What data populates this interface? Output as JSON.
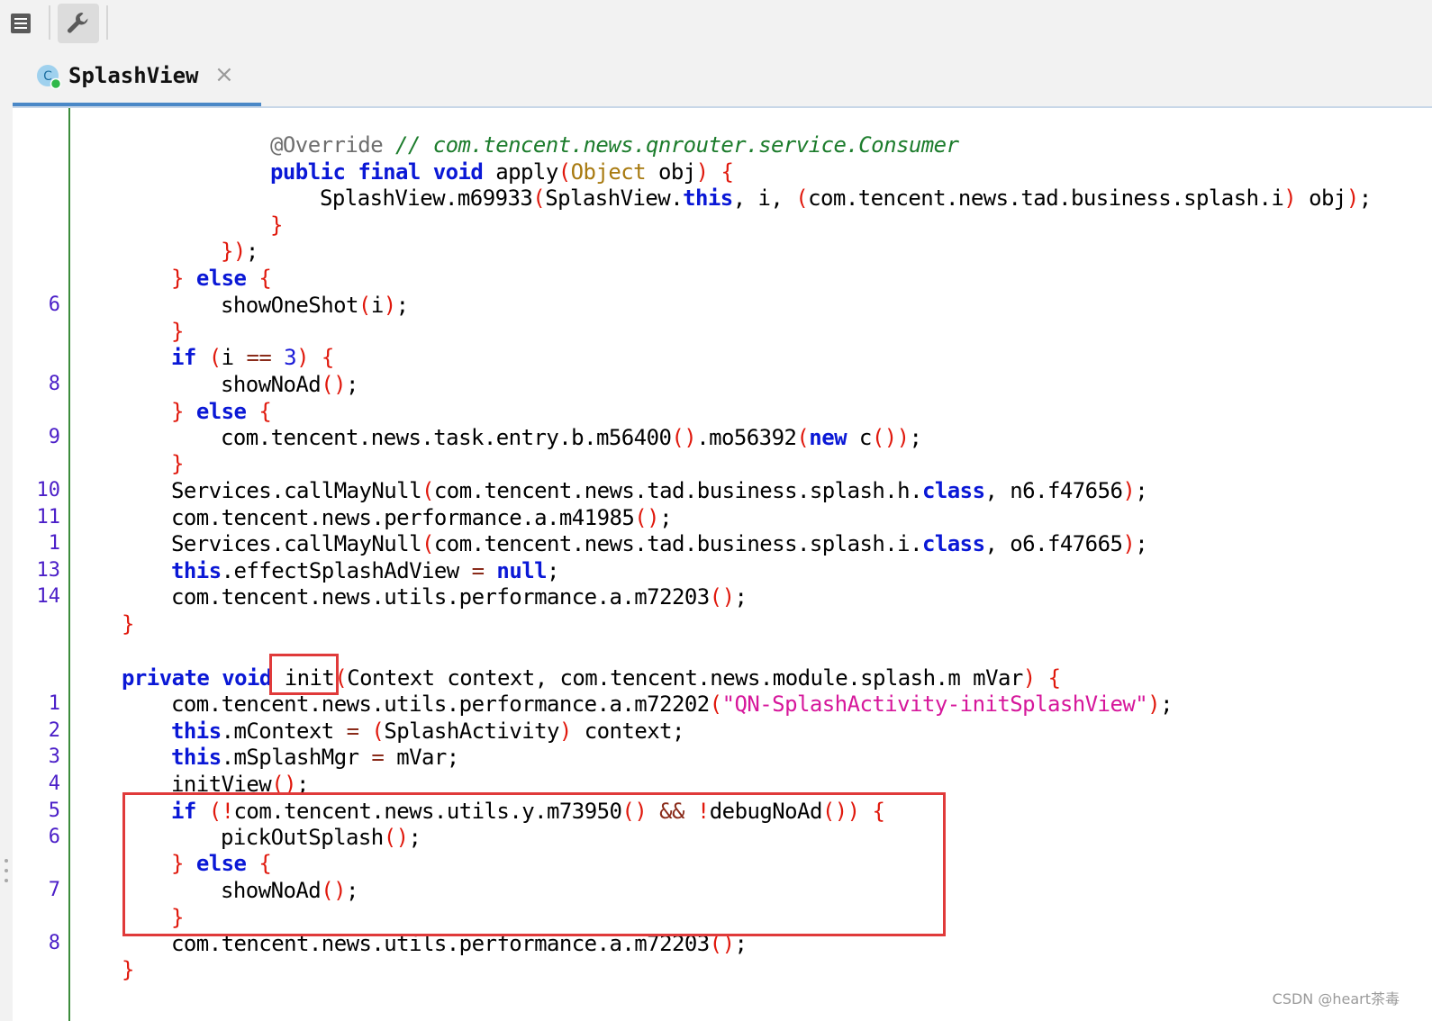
{
  "toolbar": {
    "menu_icon": "menu-icon",
    "settings_icon": "wrench-icon"
  },
  "tab": {
    "title": "SplashView",
    "close": "×",
    "icon": "class-icon"
  },
  "gutter_numbers": [
    "6",
    "8",
    "9",
    "10",
    "11",
    "1",
    "13",
    "14",
    "1",
    "2",
    "3",
    "4",
    "5",
    "6",
    "7",
    "8"
  ],
  "code": [
    [
      [
        "@Override",
        "ann"
      ],
      [
        " ",
        ""
      ],
      [
        "// com.tencent.news.qnrouter.service.Consumer",
        "cmt"
      ]
    ],
    [
      [
        "public",
        "kw"
      ],
      [
        " ",
        ""
      ],
      [
        "final",
        "kw"
      ],
      [
        " ",
        ""
      ],
      [
        "void",
        "kw"
      ],
      [
        " apply",
        ""
      ],
      [
        "(",
        "br"
      ],
      [
        "Object",
        "typ"
      ],
      [
        " obj",
        ""
      ],
      [
        ")",
        "br"
      ],
      [
        " ",
        ""
      ],
      [
        "{",
        "br"
      ]
    ],
    [
      [
        "SplashView.m69933",
        ""
      ],
      [
        "(",
        "br"
      ],
      [
        "SplashView.",
        ""
      ],
      [
        "this",
        "kw"
      ],
      [
        ", i, ",
        ""
      ],
      [
        "(",
        "br"
      ],
      [
        "com.tencent.news.tad.business.splash.i",
        ""
      ],
      [
        ")",
        "br"
      ],
      [
        " obj",
        ""
      ],
      [
        ")",
        "br"
      ],
      [
        ";",
        ""
      ]
    ],
    [
      [
        "}",
        "br"
      ]
    ],
    [
      [
        "})",
        "br"
      ],
      [
        ";",
        ""
      ]
    ],
    [
      [
        "}",
        "br"
      ],
      [
        " ",
        ""
      ],
      [
        "else",
        "kw"
      ],
      [
        " ",
        ""
      ],
      [
        "{",
        "br"
      ]
    ],
    [
      [
        "showOneShot",
        ""
      ],
      [
        "(",
        "br"
      ],
      [
        "i",
        ""
      ],
      [
        ")",
        "br"
      ],
      [
        ";",
        ""
      ]
    ],
    [
      [
        "}",
        "br"
      ]
    ],
    [
      [
        "if",
        "kw"
      ],
      [
        " ",
        ""
      ],
      [
        "(",
        "br"
      ],
      [
        "i ",
        ""
      ],
      [
        "==",
        "op"
      ],
      [
        " ",
        ""
      ],
      [
        "3",
        "num"
      ],
      [
        ")",
        "br"
      ],
      [
        " ",
        ""
      ],
      [
        "{",
        "br"
      ]
    ],
    [
      [
        "showNoAd",
        ""
      ],
      [
        "()",
        "br"
      ],
      [
        ";",
        ""
      ]
    ],
    [
      [
        "}",
        "br"
      ],
      [
        " ",
        ""
      ],
      [
        "else",
        "kw"
      ],
      [
        " ",
        ""
      ],
      [
        "{",
        "br"
      ]
    ],
    [
      [
        "com.tencent.news.task.entry.b.m56400",
        ""
      ],
      [
        "()",
        "br"
      ],
      [
        ".mo56392",
        ""
      ],
      [
        "(",
        "br"
      ],
      [
        "new",
        "kw"
      ],
      [
        " c",
        ""
      ],
      [
        "())",
        "br"
      ],
      [
        ";",
        ""
      ]
    ],
    [
      [
        "}",
        "br"
      ]
    ],
    [
      [
        "Services.callMayNull",
        ""
      ],
      [
        "(",
        "br"
      ],
      [
        "com.tencent.news.tad.business.splash.h.",
        ""
      ],
      [
        "class",
        "kw"
      ],
      [
        ", n6.f47656",
        ""
      ],
      [
        ")",
        "br"
      ],
      [
        ";",
        ""
      ]
    ],
    [
      [
        "com.tencent.news.performance.a.m41985",
        ""
      ],
      [
        "()",
        "br"
      ],
      [
        ";",
        ""
      ]
    ],
    [
      [
        "Services.callMayNull",
        ""
      ],
      [
        "(",
        "br"
      ],
      [
        "com.tencent.news.tad.business.splash.i.",
        ""
      ],
      [
        "class",
        "kw"
      ],
      [
        ", o6.f47665",
        ""
      ],
      [
        ")",
        "br"
      ],
      [
        ";",
        ""
      ]
    ],
    [
      [
        "this",
        "kw"
      ],
      [
        ".effectSplashAdView ",
        ""
      ],
      [
        "=",
        "op"
      ],
      [
        " ",
        ""
      ],
      [
        "null",
        "kw"
      ],
      [
        ";",
        ""
      ]
    ],
    [
      [
        "com.tencent.news.utils.performance.a.m72203",
        ""
      ],
      [
        "()",
        "br"
      ],
      [
        ";",
        ""
      ]
    ],
    [
      [
        "}",
        "br"
      ]
    ],
    [],
    [
      [
        "private",
        "kw"
      ],
      [
        " ",
        ""
      ],
      [
        "void",
        "kw"
      ],
      [
        " init",
        ""
      ],
      [
        "(",
        "br"
      ],
      [
        "Context context, com.tencent.news.module.splash.m mVar",
        ""
      ],
      [
        ")",
        "br"
      ],
      [
        " ",
        ""
      ],
      [
        "{",
        "br"
      ]
    ],
    [
      [
        "com.tencent.news.utils.performance.a.m72202",
        ""
      ],
      [
        "(",
        "br"
      ],
      [
        "\"QN-SplashActivity-initSplashView\"",
        "str"
      ],
      [
        ")",
        "br"
      ],
      [
        ";",
        ""
      ]
    ],
    [
      [
        "this",
        "kw"
      ],
      [
        ".mContext ",
        ""
      ],
      [
        "=",
        "op"
      ],
      [
        " ",
        ""
      ],
      [
        "(",
        "br"
      ],
      [
        "SplashActivity",
        ""
      ],
      [
        ")",
        "br"
      ],
      [
        " context;",
        ""
      ]
    ],
    [
      [
        "this",
        "kw"
      ],
      [
        ".mSplashMgr ",
        ""
      ],
      [
        "=",
        "op"
      ],
      [
        " mVar;",
        ""
      ]
    ],
    [
      [
        "initView",
        ""
      ],
      [
        "()",
        "br"
      ],
      [
        ";",
        ""
      ]
    ],
    [
      [
        "if",
        "kw"
      ],
      [
        " ",
        ""
      ],
      [
        "(!",
        "br"
      ],
      [
        "com.tencent.news.utils.y.m73950",
        ""
      ],
      [
        "()",
        "br"
      ],
      [
        " ",
        ""
      ],
      [
        "&&",
        "op"
      ],
      [
        " ",
        ""
      ],
      [
        "!",
        "br"
      ],
      [
        "debugNoAd",
        ""
      ],
      [
        "())",
        "br"
      ],
      [
        " ",
        ""
      ],
      [
        "{",
        "br"
      ]
    ],
    [
      [
        "pickOutSplash",
        ""
      ],
      [
        "()",
        "br"
      ],
      [
        ";",
        ""
      ]
    ],
    [
      [
        "}",
        "br"
      ],
      [
        " ",
        ""
      ],
      [
        "else",
        "kw"
      ],
      [
        " ",
        ""
      ],
      [
        "{",
        "br"
      ]
    ],
    [
      [
        "showNoAd",
        ""
      ],
      [
        "()",
        "br"
      ],
      [
        ";",
        ""
      ]
    ],
    [
      [
        "}",
        "br"
      ]
    ],
    [
      [
        "com.tencent.news.utils.performance.a.m72203",
        ""
      ],
      [
        "()",
        "br"
      ],
      [
        ";",
        ""
      ]
    ],
    [
      [
        "}",
        "br"
      ]
    ]
  ],
  "watermark": "CSDN @heart茶毒"
}
